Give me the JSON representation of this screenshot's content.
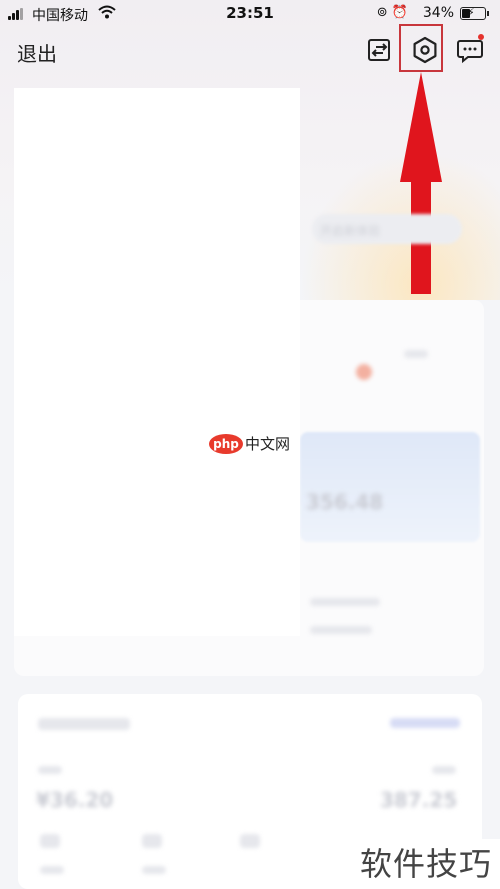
{
  "status_bar": {
    "carrier": "中国移动",
    "time": "23:51",
    "battery": "34%"
  },
  "header": {
    "logout_label": "退出"
  },
  "blurred_content": {
    "amount_left": "¥36.20",
    "amount_right": "387.25",
    "value_mid": "356.48",
    "pill_label": "开启新体验"
  },
  "watermarks": {
    "php_logo_text": "php",
    "php_site_text": "中文网",
    "corner_text": "软件技巧"
  },
  "colors": {
    "highlight_box": "#c8363c",
    "arrow": "#e0151d",
    "notification_dot": "#e5322d"
  }
}
